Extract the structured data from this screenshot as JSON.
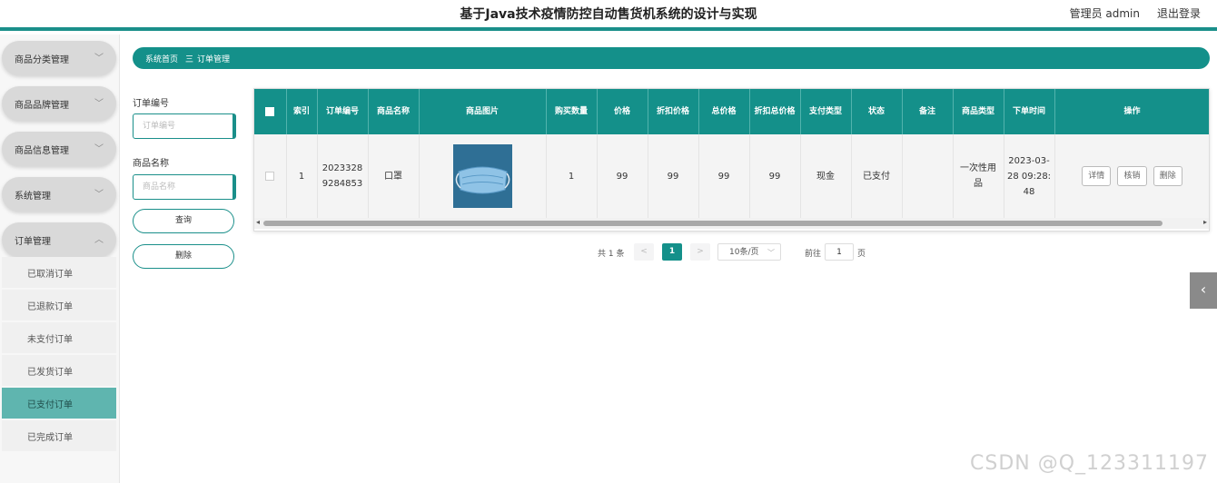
{
  "header": {
    "title": "基于Java技术疫情防控自动售货机系统的设计与实现",
    "admin": "管理员 admin",
    "logout": "退出登录"
  },
  "sidebar": {
    "groups": [
      {
        "label": "商品分类管理",
        "expanded": false
      },
      {
        "label": "商品品牌管理",
        "expanded": false
      },
      {
        "label": "商品信息管理",
        "expanded": false
      },
      {
        "label": "系统管理",
        "expanded": false
      },
      {
        "label": "订单管理",
        "expanded": true
      }
    ],
    "sub_items": [
      {
        "label": "已取消订单",
        "active": false
      },
      {
        "label": "已退款订单",
        "active": false
      },
      {
        "label": "未支付订单",
        "active": false
      },
      {
        "label": "已发货订单",
        "active": false
      },
      {
        "label": "已支付订单",
        "active": true
      },
      {
        "label": "已完成订单",
        "active": false
      }
    ]
  },
  "breadcrumb": {
    "home": "系统首页",
    "separator": "三",
    "current": "订单管理"
  },
  "filters": {
    "order_no_label": "订单编号",
    "order_no_placeholder": "订单编号",
    "product_label": "商品名称",
    "product_placeholder": "商品名称",
    "query_button": "查询",
    "delete_button": "删除"
  },
  "table": {
    "headers": [
      "索引",
      "订单编号",
      "商品名称",
      "商品图片",
      "购买数量",
      "价格",
      "折扣价格",
      "总价格",
      "折扣总价格",
      "支付类型",
      "状态",
      "备注",
      "商品类型",
      "下单时间",
      "操作"
    ],
    "rows": [
      {
        "index": "1",
        "order_no": "20233289284853",
        "product_name": "口罩",
        "image": "mask-image",
        "quantity": "1",
        "price": "99",
        "discount_price": "99",
        "total_price": "99",
        "discount_total": "99",
        "pay_type": "现金",
        "status": "已支付",
        "remark": "",
        "product_type": "一次性用品",
        "order_time": "2023-03-28 09:28:48"
      }
    ],
    "actions": [
      "详情",
      "核销",
      "删除"
    ]
  },
  "pagination": {
    "total": "共 1 条",
    "prev": "<",
    "current_page": "1",
    "next": ">",
    "page_size": "10条/页",
    "goto_label": "前往",
    "goto_value": "1",
    "page_suffix": "页"
  },
  "side_tab": {
    "icon": "chevron-left-icon",
    "glyph": "‹"
  },
  "watermark": "CSDN @Q_123311197",
  "colors": {
    "primary": "#14908a",
    "active_item": "#5fb5af"
  }
}
